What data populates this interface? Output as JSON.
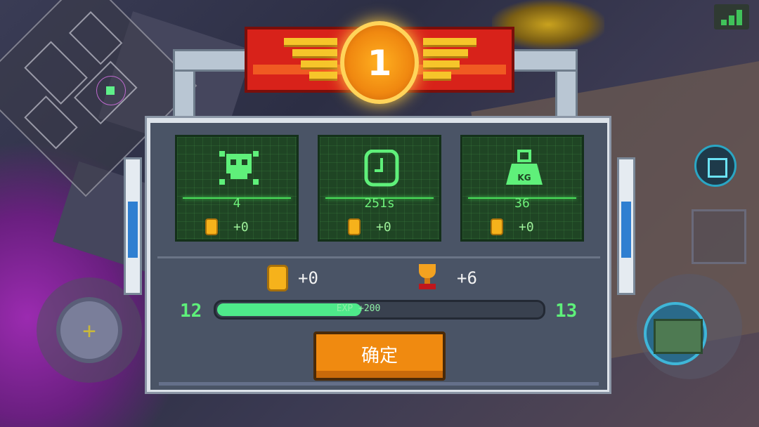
{
  "rank": "1",
  "stats": [
    {
      "icon": "skull-icon",
      "value": "4",
      "coin": "+0"
    },
    {
      "icon": "clock-icon",
      "value": "251s",
      "coin": "+0"
    },
    {
      "icon": "weight-icon",
      "icon_text": "KG",
      "value": "36",
      "coin": "+0"
    }
  ],
  "summary": {
    "coins": "+0",
    "trophies": "+6"
  },
  "exp": {
    "current_level": "12",
    "next_level": "13",
    "label": "EXP +200",
    "progress": 0.44
  },
  "confirm_label": "确定",
  "colors": {
    "panel": "#4a5466",
    "accent_green": "#4ee98a",
    "button": "#f08a10",
    "banner_red": "#d8221a"
  }
}
